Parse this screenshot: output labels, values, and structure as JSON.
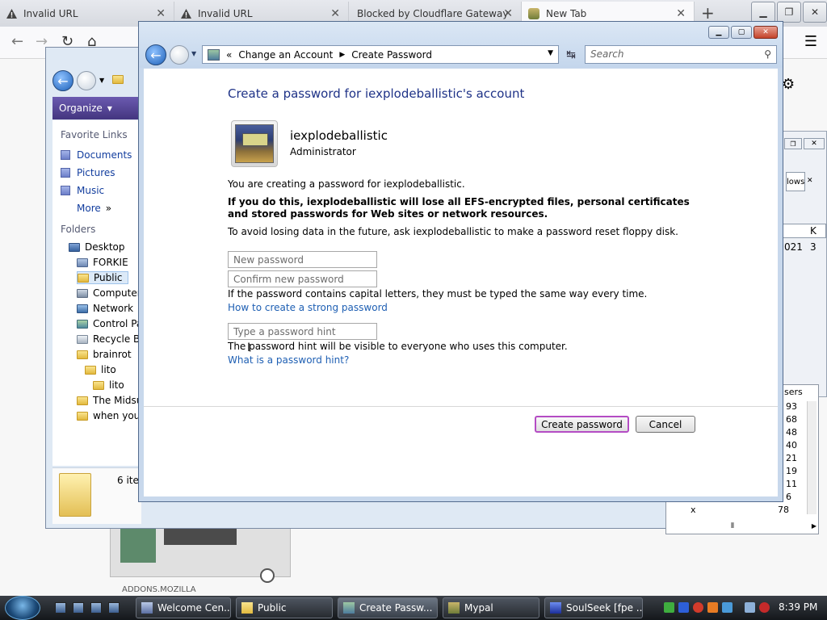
{
  "browser": {
    "tabs": [
      {
        "title": "Invalid URL"
      },
      {
        "title": "Invalid URL"
      },
      {
        "title": "Blocked by Cloudflare Gateway"
      },
      {
        "title": "New Tab"
      }
    ],
    "background_label": "ADDONS.MOZILLA"
  },
  "explorer": {
    "organize_label": "Organize",
    "favorite_links_heading": "Favorite Links",
    "favorite_links": [
      "Documents",
      "Pictures",
      "Music",
      "More"
    ],
    "folders_heading": "Folders",
    "tree": [
      "Desktop",
      "FORKIE",
      "Public",
      "Computer",
      "Network",
      "Control Pa",
      "Recycle Bi",
      "brainrot",
      "lito",
      "lito",
      "The Midsu",
      "when you"
    ],
    "item_count": "6 ite"
  },
  "right_fragments": {
    "button_label": "lows",
    "col_header": "K",
    "row_values": [
      "021",
      "3"
    ],
    "list_header": "sers",
    "list_numbers": [
      "93",
      "68",
      "48",
      "40",
      "21",
      "19",
      "11",
      "6"
    ],
    "bottom_value": "78",
    "bottom_prefix": "x"
  },
  "window": {
    "breadcrumb": [
      "Change an Account",
      "Create Password"
    ],
    "search_placeholder": "Search",
    "title": "Create a password for iexplodeballistic's account",
    "user_name": "iexplodeballistic",
    "user_role": "Administrator",
    "intro": "You are creating a password for iexplodeballistic.",
    "warning": "If you do this, iexplodeballistic will lose all EFS-encrypted files, personal certificates and stored passwords for Web sites or network resources.",
    "advice": "To avoid losing data in the future, ask iexplodeballistic to make a password reset floppy disk.",
    "new_password_placeholder": "New password",
    "confirm_password_placeholder": "Confirm new password",
    "case_note": "If the password contains capital letters, they must be typed the same way every time.",
    "strong_password_link": "How to create a strong password",
    "hint_placeholder": "Type a password hint",
    "hint_note": "The password hint will be visible to everyone who uses this computer.",
    "hint_link": "What is a password hint?",
    "create_button": "Create password",
    "cancel_button": "Cancel"
  },
  "taskbar": {
    "items": [
      "Welcome Cen...",
      "Public",
      "Create Passw...",
      "Mypal",
      "SoulSeek [fpe ..."
    ],
    "clock": "8:39 PM"
  },
  "colors": {
    "title_blue": "#1e3287",
    "link_blue": "#1e5fb3",
    "focus_border": "#b44cc4"
  }
}
